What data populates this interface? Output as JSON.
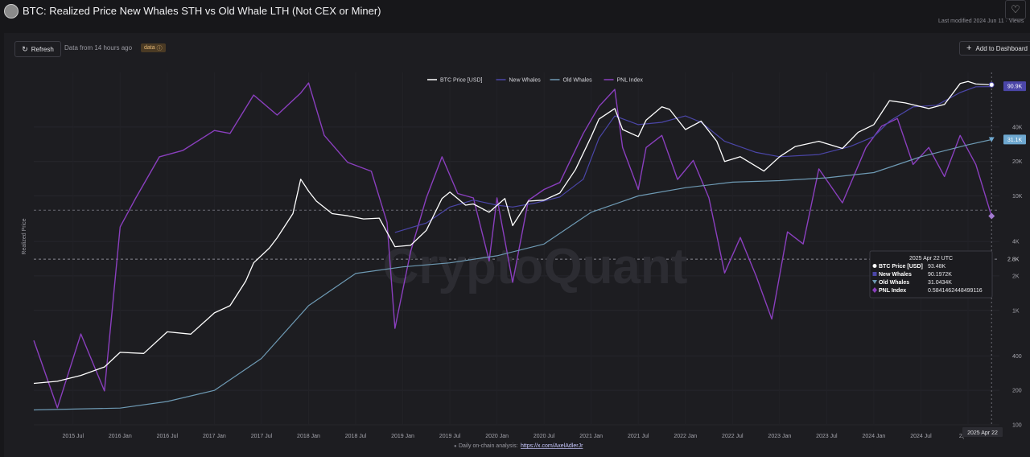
{
  "header": {
    "title": "BTC: Realized Price New Whales STH vs Old Whale LTH (Not CEX or Miner)",
    "last_modified": "Last modified 2024 Jun 11 · Views",
    "favorite_icon": "heart-icon"
  },
  "toolbar": {
    "refresh_label": "Refresh",
    "refresh_icon": "refresh-icon",
    "data_from": "Data from 14 hours ago",
    "badge_label": "data",
    "badge_icon": "info-icon",
    "add_label": "Add to Dashboard",
    "add_icon": "plus-icon"
  },
  "colors": {
    "btc": "#ffffff",
    "new_whales": "#4b46a8",
    "old_whales": "#6e9ab4",
    "pnl": "#8a3fbe",
    "background": "#1d1d21"
  },
  "chart_data": {
    "type": "line",
    "ylabel": "Realized Price",
    "yscale": "log",
    "ylim": [
      100,
      120000
    ],
    "xlim": [
      "2015-02",
      "2025-05"
    ],
    "legend": [
      "BTC Price [USD]",
      "New Whales",
      "Old Whales",
      "PNL Index"
    ],
    "legend_position": "top-center",
    "x_ticks": [
      "2015 Jul",
      "2016 Jan",
      "2016 Jul",
      "2017 Jan",
      "2017 Jul",
      "2018 Jan",
      "2018 Jul",
      "2019 Jan",
      "2019 Jul",
      "2020 Jan",
      "2020 Jul",
      "2021 Jan",
      "2021 Jul",
      "2022 Jan",
      "2022 Jul",
      "2023 Jan",
      "2023 Jul",
      "2024 Jan",
      "2024 Jul",
      "2("
    ],
    "y_ticks": [
      "100",
      "200",
      "400",
      "1K",
      "2K",
      "4K",
      "10K",
      "20K",
      "40K"
    ],
    "y_tick_values": [
      100,
      200,
      400,
      1000,
      2000,
      4000,
      10000,
      20000,
      40000
    ],
    "crosshair_date": "2025 Apr 22",
    "crosshair_y_label": "2.8K",
    "crosshair_y_value": 2800,
    "last_value_labels": [
      {
        "series": "BTC Price [USD]",
        "text": "90.9K",
        "value": 90900,
        "color": "#4b46a8"
      },
      {
        "series": "Old Whales",
        "text": "31.1K",
        "value": 31100,
        "color": "#6ea8d0"
      }
    ],
    "reference_line_value": 7500,
    "series": [
      {
        "name": "BTC Price [USD]",
        "x": [
          "2015-02",
          "2015-05",
          "2015-08",
          "2015-11",
          "2016-01",
          "2016-04",
          "2016-07",
          "2016-10",
          "2017-01",
          "2017-03",
          "2017-05",
          "2017-06",
          "2017-08",
          "2017-09",
          "2017-11",
          "2017-12",
          "2018-01",
          "2018-02",
          "2018-04",
          "2018-06",
          "2018-08",
          "2018-10",
          "2018-12",
          "2019-02",
          "2019-04",
          "2019-06",
          "2019-07",
          "2019-09",
          "2019-10",
          "2019-12",
          "2020-02",
          "2020-03",
          "2020-05",
          "2020-07",
          "2020-09",
          "2020-11",
          "2021-01",
          "2021-02",
          "2021-04",
          "2021-05",
          "2021-07",
          "2021-08",
          "2021-10",
          "2021-11",
          "2022-01",
          "2022-03",
          "2022-05",
          "2022-06",
          "2022-08",
          "2022-11",
          "2023-01",
          "2023-03",
          "2023-06",
          "2023-09",
          "2023-11",
          "2024-01",
          "2024-03",
          "2024-05",
          "2024-08",
          "2024-10",
          "2024-12",
          "2025-01",
          "2025-02",
          "2025-04"
        ],
        "y": [
          230,
          240,
          270,
          320,
          430,
          420,
          650,
          620,
          950,
          1100,
          1800,
          2600,
          3500,
          4300,
          7000,
          14000,
          11000,
          9000,
          7000,
          6700,
          6300,
          6400,
          3600,
          3700,
          5000,
          9500,
          10800,
          8300,
          8500,
          7200,
          9500,
          5500,
          9000,
          9200,
          10600,
          17000,
          33000,
          47000,
          58000,
          38000,
          33000,
          46000,
          60000,
          57000,
          38000,
          45000,
          30000,
          20000,
          22000,
          16500,
          22000,
          27000,
          30000,
          26000,
          36000,
          42000,
          68000,
          65000,
          58000,
          63000,
          96000,
          100000,
          95000,
          93480
        ]
      },
      {
        "name": "New Whales",
        "x": [
          "2018-12",
          "2019-04",
          "2019-07",
          "2019-10",
          "2020-01",
          "2020-03",
          "2020-06",
          "2020-09",
          "2020-12",
          "2021-02",
          "2021-04",
          "2021-07",
          "2021-10",
          "2022-01",
          "2022-03",
          "2022-06",
          "2022-10",
          "2023-01",
          "2023-06",
          "2023-10",
          "2024-01",
          "2024-03",
          "2024-06",
          "2024-09",
          "2024-12",
          "2025-02",
          "2025-04"
        ],
        "y": [
          4800,
          5800,
          8000,
          9200,
          8300,
          8000,
          8700,
          9800,
          14000,
          32000,
          50000,
          42000,
          44000,
          50000,
          44000,
          30000,
          24000,
          22000,
          23000,
          27000,
          33000,
          45000,
          60000,
          62000,
          80000,
          90000,
          90197
        ]
      },
      {
        "name": "Old Whales",
        "x": [
          "2015-02",
          "2016-01",
          "2016-07",
          "2017-01",
          "2017-07",
          "2018-01",
          "2018-07",
          "2019-01",
          "2019-07",
          "2020-01",
          "2020-07",
          "2021-01",
          "2021-07",
          "2022-01",
          "2022-07",
          "2023-01",
          "2023-07",
          "2024-01",
          "2024-07",
          "2025-01",
          "2025-04"
        ],
        "y": [
          135,
          140,
          160,
          200,
          380,
          1100,
          2100,
          2400,
          2600,
          3000,
          3800,
          7200,
          10000,
          11800,
          13200,
          13600,
          14400,
          16000,
          22000,
          28000,
          31043
        ]
      },
      {
        "name": "PNL Index",
        "x": [
          "2015-02",
          "2015-05",
          "2015-08",
          "2015-11",
          "2016-01",
          "2016-03",
          "2016-06",
          "2016-09",
          "2017-01",
          "2017-03",
          "2017-06",
          "2017-09",
          "2017-12",
          "2018-01",
          "2018-03",
          "2018-06",
          "2018-09",
          "2018-11",
          "2018-12",
          "2019-02",
          "2019-04",
          "2019-06",
          "2019-08",
          "2019-10",
          "2019-12",
          "2020-01",
          "2020-03",
          "2020-05",
          "2020-07",
          "2020-09",
          "2020-12",
          "2021-02",
          "2021-04",
          "2021-05",
          "2021-07",
          "2021-08",
          "2021-10",
          "2021-12",
          "2022-02",
          "2022-04",
          "2022-06",
          "2022-08",
          "2022-10",
          "2022-12",
          "2023-02",
          "2023-04",
          "2023-06",
          "2023-09",
          "2023-12",
          "2024-02",
          "2024-04",
          "2024-06",
          "2024-08",
          "2024-10",
          "2024-12",
          "2025-02",
          "2025-04"
        ],
        "y": [
          0.03,
          0.006,
          0.035,
          0.009,
          0.45,
          0.9,
          2.4,
          2.8,
          4.5,
          4.2,
          10.5,
          6.5,
          11,
          14,
          4,
          2.1,
          1.7,
          0.5,
          0.04,
          0.25,
          0.9,
          2.4,
          1.0,
          0.9,
          0.2,
          0.9,
          0.12,
          0.85,
          1.1,
          1.3,
          4.2,
          8,
          12,
          3,
          1.1,
          3,
          4,
          1.4,
          2.2,
          0.9,
          0.15,
          0.35,
          0.14,
          0.05,
          0.4,
          0.3,
          1.8,
          0.8,
          3,
          5,
          6,
          2,
          3,
          1.5,
          4,
          2,
          0.584146
        ]
      }
    ],
    "tooltip": {
      "date": "2025 Apr 22 UTC",
      "rows": [
        {
          "label": "BTC Price [USD]",
          "value": "93.48K",
          "color": "#ffffff",
          "marker": "circle"
        },
        {
          "label": "New Whales",
          "value": "90.1972K",
          "color": "#4b46a8",
          "marker": "square"
        },
        {
          "label": "Old Whales",
          "value": "31.0434K",
          "color": "#6e9ab4",
          "marker": "triangle"
        },
        {
          "label": "PNL Index",
          "value": "0.5841462448499116",
          "color": "#8a3fbe",
          "marker": "diamond"
        }
      ]
    },
    "watermark": "CryptoQuant",
    "footer": {
      "prefix": "Daily on-chain analysis:",
      "link": "https://x.com/AxelAdlerJr"
    }
  }
}
